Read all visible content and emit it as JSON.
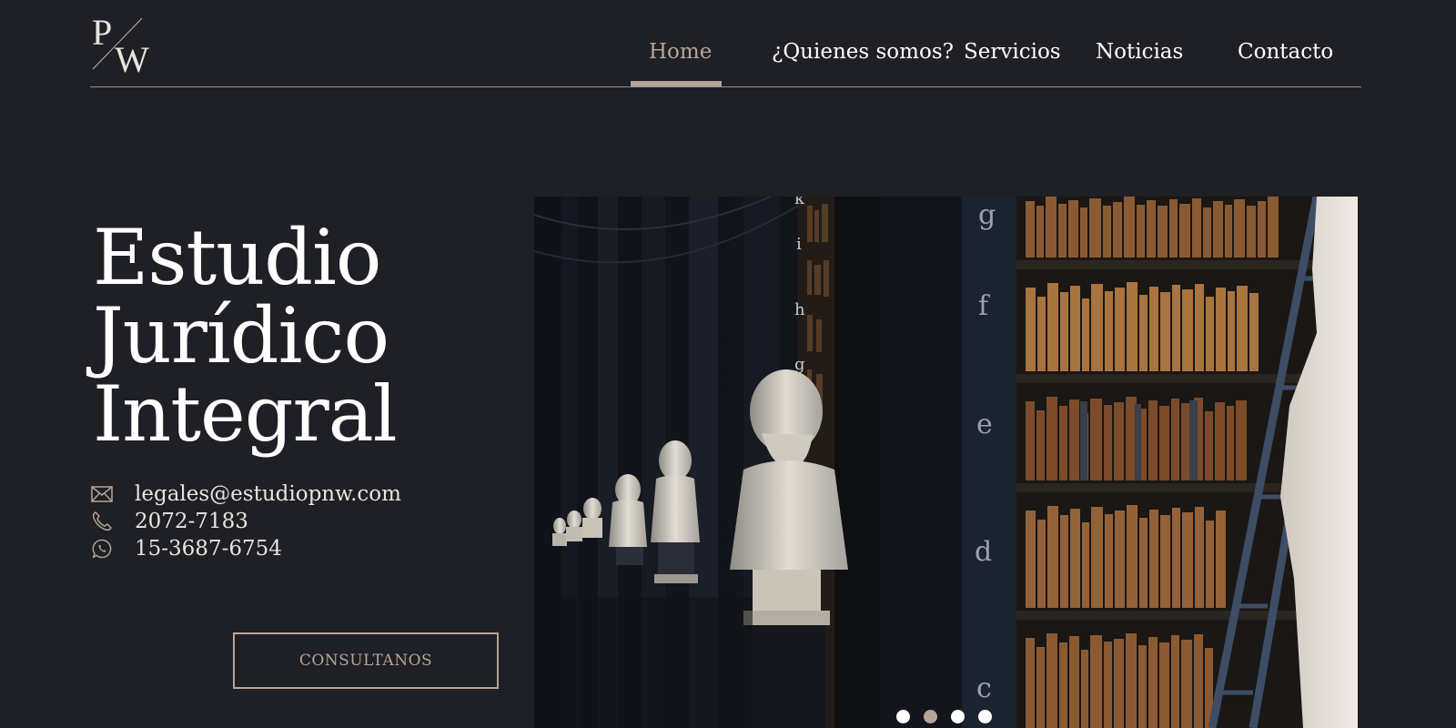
{
  "logo": {
    "letter_top": "P",
    "letter_bottom": "W"
  },
  "nav": {
    "items": [
      {
        "label": "Home",
        "active": true
      },
      {
        "label": "¿Quienes somos?",
        "active": false
      },
      {
        "label": "Servicios",
        "active": false
      },
      {
        "label": "Noticias",
        "active": false
      },
      {
        "label": "Contacto",
        "active": false
      }
    ]
  },
  "hero": {
    "title_lines": [
      "Estudio",
      "Jurídico",
      "Integral"
    ],
    "email": "legales@estudiopnw.com",
    "phone": "2072-7183",
    "whatsapp": "15-3687-6754",
    "cta_label": "CONSULTANOS",
    "image_shelf_letters": [
      "k",
      "i",
      "h",
      "g",
      "g",
      "f",
      "e",
      "d",
      "c"
    ]
  },
  "slider": {
    "count": 4,
    "active_index": 1
  },
  "colors": {
    "background": "#1f2025",
    "accent": "#b5a497",
    "text": "#ffffff"
  },
  "icons": [
    "envelope-icon",
    "phone-icon",
    "whatsapp-icon"
  ]
}
